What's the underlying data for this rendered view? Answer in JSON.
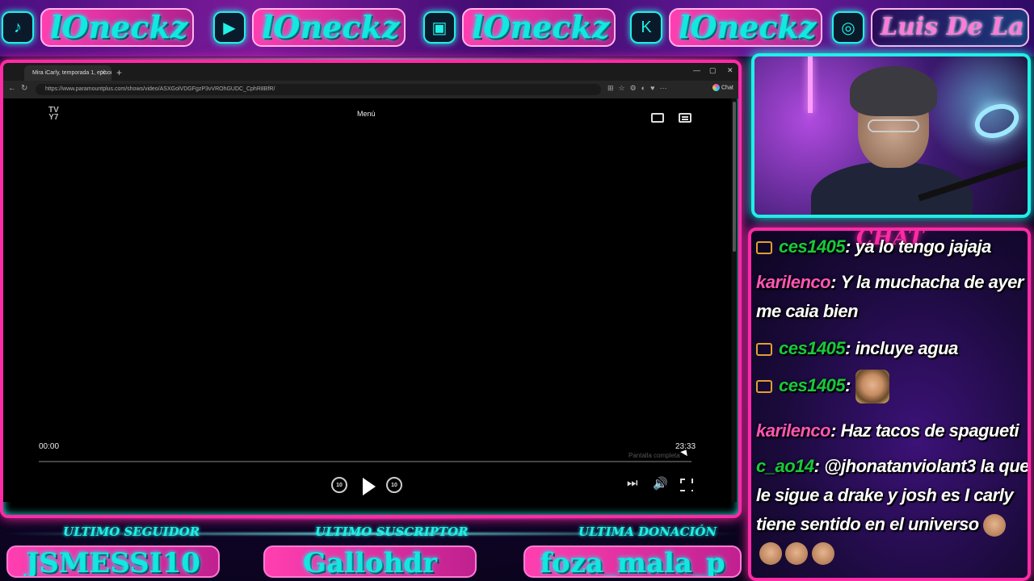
{
  "social": [
    {
      "icon": "tiktok-icon",
      "glyph": "♪",
      "name": "lOneckz"
    },
    {
      "icon": "youtube-icon",
      "glyph": "▶",
      "name": "lOneckz"
    },
    {
      "icon": "twitch-icon",
      "glyph": "▣",
      "name": "lOneckz"
    },
    {
      "icon": "kick-icon",
      "glyph": "K",
      "name": "lOneckz"
    },
    {
      "icon": "instagram-icon",
      "glyph": "◎",
      "name": "Luis De La Torre"
    }
  ],
  "browser": {
    "tab_title": "Mira iCarly, temporada 1, episodio",
    "url": "https://www.paramountplus.com/shows/video/ASXGolVDGFgzP3vVROhGUDC_CphR8BfR/",
    "chat_label": "Chat"
  },
  "player": {
    "rating": "TV Y7",
    "rating_top": "TV",
    "rating_bottom": "Y7",
    "menu": "Menú",
    "time_current": "00:00",
    "time_total": "23:33",
    "tooltip": "Pantalla completa",
    "progress": 0,
    "rewind_label": "10",
    "forward_label": "10"
  },
  "chat": {
    "title": "CHAT",
    "messages": [
      {
        "user": "ces1405",
        "color": "green",
        "badge": true,
        "text": "ya lo tengo jajaja"
      },
      {
        "user": "karilenco",
        "color": "pink",
        "badge": false,
        "text": "Y la muchacha de ayer me caia bien"
      },
      {
        "user": "ces1405",
        "color": "green",
        "badge": true,
        "text": "incluye agua"
      },
      {
        "user": "ces1405",
        "color": "green",
        "badge": true,
        "text": ""
      },
      {
        "user": "karilenco",
        "color": "pink",
        "badge": false,
        "text": "Haz tacos de spagueti"
      },
      {
        "user": "c_ao14",
        "color": "green",
        "badge": false,
        "text": "@jhonatanviolant3 la que le sigue a drake y josh es I carly tiene sentido en el universo"
      }
    ]
  },
  "bottom": {
    "follower_label": "ULTIMO SEGUIDOR",
    "follower": "JSMESSI10",
    "subscriber_label": "ULTIMO SUSCRIPTOR",
    "subscriber": "Gallohdr",
    "donation_label": "ULTIMA DONACIÓN",
    "donation": "foza_mala_p"
  },
  "colors": {
    "accent_cyan": "#1ff0e6",
    "accent_pink": "#ff2aa6",
    "green_user": "#19c93a",
    "pink_user": "#ff55b8"
  }
}
